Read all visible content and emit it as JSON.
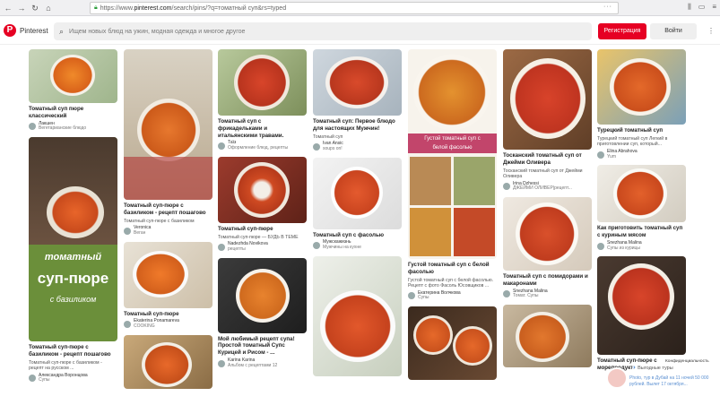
{
  "browser": {
    "url_prefix": "https://www.",
    "url_domain": "pinterest.com",
    "url_path": "/search/pins/?q=томатный суп&rs=typed",
    "dots": "···"
  },
  "header": {
    "brand": "Pinterest",
    "search_placeholder": "Ищем новых блюд на ужин, модная одежда и многое другое",
    "register": "Регистрация",
    "login": "Войти",
    "more": "⋮"
  },
  "pins": {
    "c1p1": {
      "title": "Томатный суп пюре классический",
      "author": "Лакшен",
      "board": "Вегетарианские блюдо"
    },
    "c1p2": {
      "overlay1": "томатный",
      "overlay2": "суп-пюре",
      "overlay3": "с базиликом",
      "title": "Томатный суп-пюре с базиликом - рецепт пошагово",
      "desc": "Томатный суп-пюре с базиликом - рецепт на русском ...",
      "author": "Александра Воронцова",
      "board": "Супы"
    },
    "c2p1": {
      "title": "Томатный суп-пюре с базиликом - рецепт пошагово",
      "desc": "Томатный суп-пюре с базиликом",
      "author": "Veronica",
      "board": "Веган"
    },
    "c2p2": {
      "title": "Томатный суп-пюре",
      "author": "Ekaterina Ponamareva",
      "board": "COOKING"
    },
    "c3p1": {
      "title": "Томатный суп с фрикадельками и итальянскими травами.",
      "author": "Таїз",
      "board": "Оформление блюд, рецепты"
    },
    "c3p2": {
      "title": "Томатный суп-пюре",
      "desc": "Томатный суп-пюре — БУДЬ В ТЕМЕ",
      "author": "Nadezhda Novikova",
      "board": "рецепты"
    },
    "c3p3": {
      "title": "Мой любимый рецепт супа! Простой томатный Супс Курицей и Рисом - ...",
      "author": "Karina Karina",
      "board": "Альбом с рецептами 12"
    },
    "c4p1": {
      "title": "Томатный суп: Первое блюдо для настоящих Мужчин!",
      "desc": "Томатный суп",
      "author": "Ivan Ansic",
      "board": "soups on!"
    },
    "c4p2": {
      "title": "Томатный суп с фасолью",
      "author": "Мужскажизнь",
      "board": "Мужчины на кухне"
    },
    "c5p1": {
      "overlay1": "Густой томатный суп с",
      "overlay2": "белой фасолью",
      "title": "Густой томатный суп с белой фасолью",
      "desc": "Густой томатный суп с белой фасолью. Рецепт с фото Фасоль Юсовщиков ...",
      "author": "Екатерина Волчкова",
      "board": "Супы"
    },
    "c6p1": {
      "title": "Тосканский томатный суп от Джейми Оливера",
      "desc": "Тосканский томатный суп от Джейми Оливера",
      "author": "Irina Dzhessi",
      "board": "ДЖЕЙМИ ОЛИВЕР|рецепт..."
    },
    "c6p2": {
      "title": "Томатный суп с помидорами и макаронами",
      "author": "Snezhana Malina",
      "board": "Томат. Супы"
    },
    "c7p1": {
      "title": "Турецкий томатный суп",
      "desc": "Турецкий томатный суп Легкий в приготовлении суп, который...",
      "author": "Elina Abrahova",
      "board": "Yum"
    },
    "c7p2": {
      "title": "Как приготовить томатный суп с куриным мясом",
      "author": "Snezhana Malina",
      "board": "Супы из курицы"
    },
    "c7p3": {
      "title": "Томатный суп-пюре с морепродуктами"
    }
  },
  "overlay": {
    "toast": "Выгодные туры",
    "caption": "Конфиденциальность",
    "blue": "Photo, тур в Дубай на 11 ночей 50 000 рублей. Вылет 17 октября..."
  },
  "colors": {
    "brand": "#e60023"
  }
}
